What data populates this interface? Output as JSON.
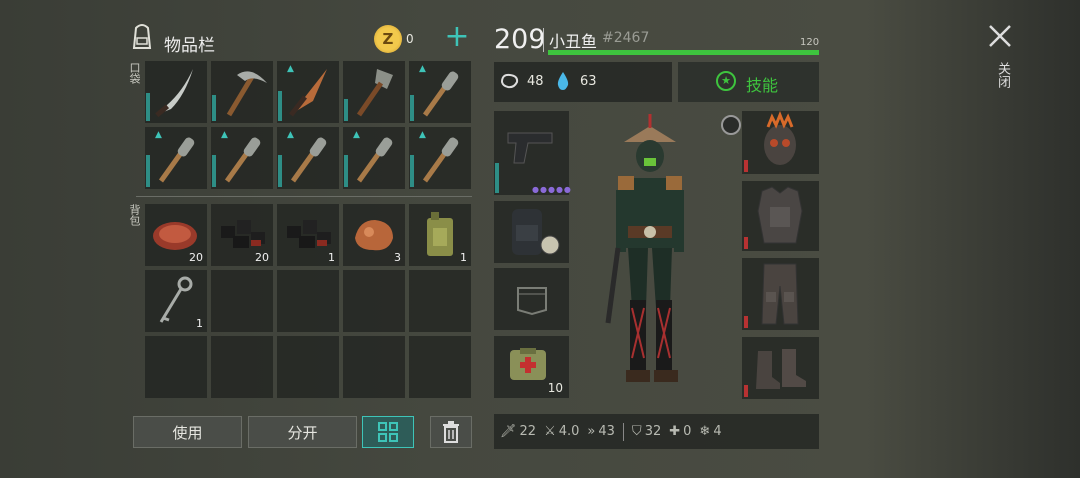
{
  "inventory": {
    "title": "物品栏",
    "coins": "0",
    "pocket_label": "口袋",
    "backpack_label": "背包",
    "pocket_items": [
      {
        "icon": "machete-icon",
        "count": "",
        "tag": false
      },
      {
        "icon": "pickaxe-icon",
        "count": "",
        "tag": false
      },
      {
        "icon": "knife-icon",
        "count": "",
        "tag": true
      },
      {
        "icon": "shovel-icon",
        "count": "",
        "tag": false
      },
      {
        "icon": "spiked-bat-icon",
        "count": "",
        "tag": true
      },
      {
        "icon": "spiked-bat-icon",
        "count": "",
        "tag": true
      },
      {
        "icon": "spiked-bat-icon",
        "count": "",
        "tag": true
      },
      {
        "icon": "spiked-bat-icon",
        "count": "",
        "tag": true
      },
      {
        "icon": "spiked-bat-icon",
        "count": "",
        "tag": true
      },
      {
        "icon": "spiked-bat-icon",
        "count": "",
        "tag": true
      }
    ],
    "backpack_items": [
      {
        "icon": "steak-icon",
        "count": "20"
      },
      {
        "icon": "coal-icon",
        "count": "20"
      },
      {
        "icon": "coal-icon",
        "count": "1"
      },
      {
        "icon": "copper-ore-icon",
        "count": "3"
      },
      {
        "icon": "jerrycan-icon",
        "count": "1"
      },
      {
        "icon": "key-icon",
        "count": "1"
      }
    ],
    "buttons": {
      "use": "使用",
      "split": "分开"
    }
  },
  "player": {
    "level": "209",
    "name": "小丑鱼",
    "id": "#2467",
    "health": "120",
    "health_fraction": 1.0,
    "hunger": "48",
    "thirst": "63",
    "skills_label": "技能",
    "medkit_count": "10"
  },
  "stats": {
    "damage": "22",
    "attack_speed": "4.0",
    "speed": "43",
    "armor": "32",
    "bleed_protection": "0",
    "cold_protection": "4"
  },
  "close_label": "关闭",
  "colors": {
    "health": "#3ec43e",
    "accent": "#2ea89c",
    "durability_low": "#b83232"
  }
}
